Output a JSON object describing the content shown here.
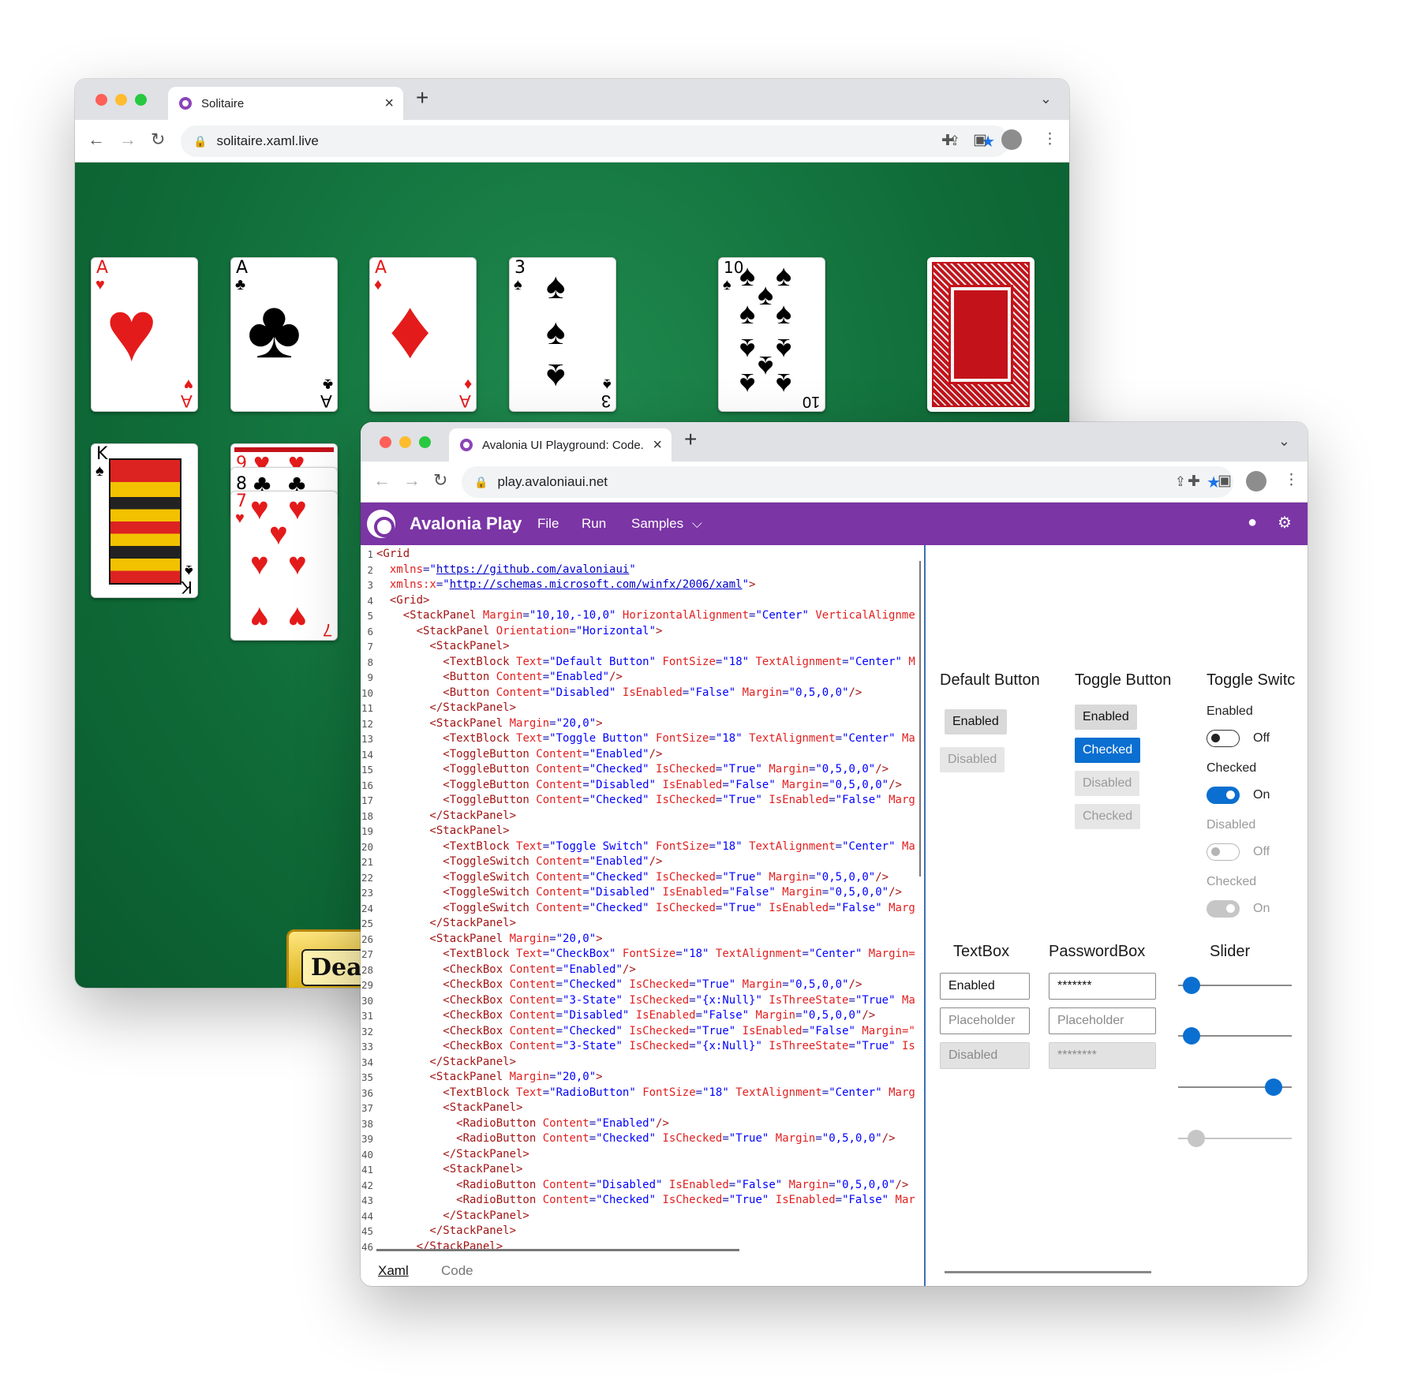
{
  "solitaire_window": {
    "tab_title": "Solitaire",
    "url": "solitaire.xaml.live",
    "foundation": [
      {
        "rank": "A",
        "suit": "♥",
        "color": "red"
      },
      {
        "rank": "A",
        "suit": "♣",
        "color": "blk"
      },
      {
        "rank": "A",
        "suit": "♦",
        "color": "red"
      },
      {
        "rank": "3",
        "suit": "♠",
        "color": "blk"
      },
      {
        "rank": "10",
        "suit": "♠",
        "color": "blk"
      }
    ],
    "tableau": [
      {
        "rank": "K",
        "suit": "♠",
        "color": "blk"
      },
      {
        "rank": "9",
        "suit": "♥",
        "color": "red"
      },
      {
        "rank": "8",
        "suit": "♣",
        "color": "blk"
      },
      {
        "rank": "7",
        "suit": "♥",
        "color": "red"
      }
    ],
    "deal_label": "Deal"
  },
  "avalonia_window": {
    "tab_title": "Avalonia UI Playground: Code...",
    "url": "play.avaloniaui.net",
    "menu": {
      "brand": "Avalonia Play",
      "file": "File",
      "run": "Run",
      "samples": "Samples",
      "github_icon": "github-icon",
      "settings_icon": "gear-icon"
    },
    "bottom_tabs": {
      "xaml": "Xaml",
      "code": "Code"
    },
    "preview": {
      "default_button": {
        "header": "Default Button",
        "enabled": "Enabled",
        "disabled": "Disabled"
      },
      "toggle_button": {
        "header": "Toggle Button",
        "items": [
          "Enabled",
          "Checked",
          "Disabled",
          "Checked"
        ]
      },
      "toggle_switch": {
        "header": "Toggle Switc",
        "enabled_label": "Enabled",
        "enabled_state": "Off",
        "checked_label": "Checked",
        "checked_state": "On",
        "disabled_label": "Disabled",
        "disabled_state": "Off",
        "checked_disabled_label": "Checked",
        "checked_disabled_state": "On"
      },
      "textbox": {
        "header": "TextBox",
        "enabled": "Enabled",
        "placeholder": "Placeholder",
        "disabled": "Disabled"
      },
      "passwordbox": {
        "header": "PasswordBox",
        "value": "*******",
        "placeholder": "Placeholder",
        "disabled": "********"
      },
      "slider": {
        "header": "Slider",
        "values": [
          0.05,
          0.05,
          0.9,
          0.1
        ]
      }
    }
  },
  "colors": {
    "purple": "#7b35a5",
    "accent": "#0a6fd0",
    "felt": "#0f6b38"
  }
}
